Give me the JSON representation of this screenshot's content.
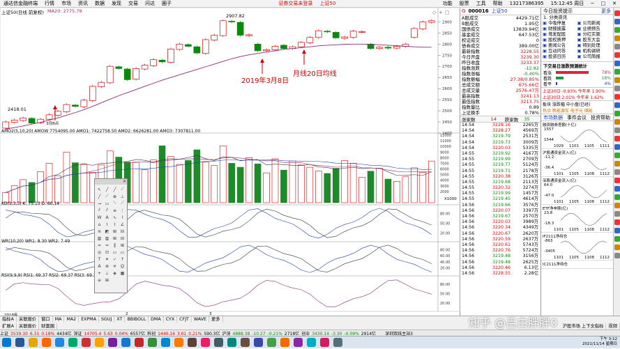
{
  "menubar": {
    "app_title": "通达信金融终端",
    "items": [
      "行情",
      "市场",
      "资讯",
      "数据",
      "发现",
      "交易",
      "问达",
      "圈子"
    ],
    "alert": "证券交易未登录",
    "index_label": "上证50",
    "right_items": [
      "功能",
      "股票",
      "工具",
      "帮助"
    ],
    "phone": "13217386395",
    "time": "15:12:45 周日"
  },
  "chart": {
    "title": "上证50(日线 前复权)",
    "ma_label": "MA20: 2775.79",
    "high_label": "2907.82",
    "low_label": "2418.01",
    "buy_point_label": "3月B点",
    "annotation_date": "2019年3月8日",
    "annotation_ma": "月线20日均线",
    "price_ticks": [
      "2900",
      "2850",
      "2800",
      "2750",
      "2700",
      "2650",
      "2600",
      "2550",
      "2500",
      "2450",
      "2400"
    ],
    "amo_label": "AMO2(5,10,20) AMOW 7754095.00 AMO1: 7422758.50 AMO2: 6626281.00 AMO3: 7307811.00",
    "amo_ticks": [
      "12000",
      "11000",
      "10000",
      "9000",
      "8000",
      "7000",
      "6000",
      "5000",
      "4000",
      "3000",
      "2000"
    ],
    "amo_unit": "X1000",
    "kdj_label": "KD(9,3,3) K: 75.13 D: 60.14",
    "kdj_ticks": [
      "80.00",
      "50.00",
      "20.00"
    ],
    "wr_label": "WR(10,20) WR1: 8.30 WR2: 7.49",
    "wr_ticks": [
      "80.00",
      "60.00",
      "40.00",
      "20.00"
    ],
    "rsi_label": "RSI(9,9,9) RSI1: 69.37 RSI2: 69.37 RSI3: 69.37",
    "rsi_ticks": [
      "80.00",
      "50.00",
      "20.00"
    ],
    "date_axis": [
      "2018年",
      "2",
      "3"
    ],
    "chart_data": {
      "type": "candlestick",
      "title": "上证50(日线 前复权)",
      "candles": [
        {
          "o": 2422,
          "c": 2450
        },
        {
          "o": 2448,
          "c": 2458
        },
        {
          "o": 2456,
          "c": 2468
        },
        {
          "o": 2466,
          "c": 2445
        },
        {
          "o": 2446,
          "c": 2462
        },
        {
          "o": 2462,
          "c": 2482
        },
        {
          "o": 2480,
          "c": 2498
        },
        {
          "o": 2496,
          "c": 2528
        },
        {
          "o": 2526,
          "c": 2520
        },
        {
          "o": 2518,
          "c": 2548
        },
        {
          "o": 2546,
          "c": 2610
        },
        {
          "o": 2608,
          "c": 2628
        },
        {
          "o": 2626,
          "c": 2700
        },
        {
          "o": 2698,
          "c": 2690
        },
        {
          "o": 2688,
          "c": 2640
        },
        {
          "o": 2642,
          "c": 2690
        },
        {
          "o": 2688,
          "c": 2705
        },
        {
          "o": 2703,
          "c": 2730
        },
        {
          "o": 2728,
          "c": 2720
        },
        {
          "o": 2718,
          "c": 2778
        },
        {
          "o": 2776,
          "c": 2800
        },
        {
          "o": 2798,
          "c": 2790
        },
        {
          "o": 2788,
          "c": 2760
        },
        {
          "o": 2758,
          "c": 2820
        },
        {
          "o": 2818,
          "c": 2840
        },
        {
          "o": 2838,
          "c": 2905
        },
        {
          "o": 2903,
          "c": 2900
        },
        {
          "o": 2898,
          "c": 2840
        },
        {
          "o": 2838,
          "c": 2842
        },
        {
          "o": 2800,
          "c": 2770
        },
        {
          "o": 2770,
          "c": 2775
        },
        {
          "o": 2774,
          "c": 2790
        },
        {
          "o": 2795,
          "c": 2780
        },
        {
          "o": 2780,
          "c": 2788
        },
        {
          "o": 2788,
          "c": 2808
        },
        {
          "o": 2806,
          "c": 2830
        },
        {
          "o": 2830,
          "c": 2860
        },
        {
          "o": 2858,
          "c": 2855
        },
        {
          "o": 2853,
          "c": 2828
        },
        {
          "o": 2826,
          "c": 2832
        },
        {
          "o": 2830,
          "c": 2858
        },
        {
          "o": 2856,
          "c": 2856
        },
        {
          "o": 2800,
          "c": 2780
        },
        {
          "o": 2780,
          "c": 2786
        },
        {
          "o": 2786,
          "c": 2782
        },
        {
          "o": 2782,
          "c": 2790
        },
        {
          "o": 2790,
          "c": 2800
        },
        {
          "o": 2830,
          "c": 2870
        },
        {
          "o": 2868,
          "c": 2900
        },
        {
          "o": 2898,
          "c": 2905
        }
      ],
      "ma20": [
        2418,
        2425,
        2432,
        2440,
        2448,
        2458,
        2468,
        2480,
        2492,
        2505,
        2520,
        2536,
        2552,
        2568,
        2582,
        2596,
        2610,
        2624,
        2638,
        2650,
        2662,
        2674,
        2686,
        2698,
        2710,
        2722,
        2734,
        2744,
        2752,
        2758,
        2764,
        2770,
        2776,
        2780,
        2784,
        2788,
        2792,
        2795,
        2797,
        2799,
        2800,
        2800,
        2799,
        2797,
        2795,
        2793,
        2790,
        2788,
        2786,
        2786
      ],
      "ylim": [
        2400,
        2920
      ],
      "amo": [
        1800,
        3000,
        4100,
        3600,
        5500,
        7000,
        4800,
        9000,
        7100,
        6800,
        5400,
        6700,
        9200,
        8100,
        7200,
        7200,
        5900,
        7600,
        10100,
        8200,
        6800,
        7500,
        9400,
        7200,
        6600,
        10100,
        7000,
        6300,
        8000,
        6900,
        5300,
        7800,
        5800,
        7400,
        6700,
        6300,
        5600,
        5200,
        6100,
        7500,
        7000,
        4500,
        5600,
        6100,
        4200,
        3800,
        4600,
        6200,
        5400,
        7400
      ],
      "amo_ylim": [
        0,
        12000
      ]
    }
  },
  "draw_toolbar": {
    "title": "画线工具"
  },
  "quote": {
    "code": "000016",
    "name": "上证50",
    "rows": [
      {
        "k": "A股成交",
        "v": "4429.71亿"
      },
      {
        "k": "B股成交",
        "v": "1.95亿"
      },
      {
        "k": "国债成交",
        "v": "13839.94亿"
      },
      {
        "k": "基金成交",
        "v": "647.53亿"
      },
      {
        "k": "权证成交",
        "v": "0"
      },
      {
        "k": "债券成交",
        "v": "389.00亿"
      },
      {
        "k": "最新指数",
        "v": "3228.55"
      },
      {
        "k": "今日开盘",
        "v": "3239.30"
      },
      {
        "k": "昨日收盘",
        "v": "3233.37"
      },
      {
        "k": "指数涨跌",
        "v": "-12.82"
      },
      {
        "k": "指数涨幅",
        "v": "-0.40%"
      },
      {
        "k": "指数振幅",
        "v": "27.38/0.85%"
      },
      {
        "k": "总成交额",
        "v": "675.66亿"
      },
      {
        "k": "总成交量",
        "v": "2576.47万"
      },
      {
        "k": "最高指数",
        "v": "3241.13"
      },
      {
        "k": "最低指数",
        "v": "3213.75"
      },
      {
        "k": "指数量比",
        "v": "0.89"
      },
      {
        "k": "上证换手",
        "v": "0.78%"
      }
    ],
    "rise_label": "涨家数",
    "rise_value": "14",
    "fall_label": "跌家数",
    "fall_value": "35",
    "ticks": [
      [
        "14:54",
        "3228.16",
        "2265万"
      ],
      [
        "14:54",
        "3228.27",
        "4569万"
      ],
      [
        "14:54",
        "3219.79",
        "2531万"
      ],
      [
        "14:54",
        "3219.73",
        "3009万"
      ],
      [
        "14:54",
        "3220.03",
        "5335万"
      ],
      [
        "14:55",
        "3219.92",
        "4167万"
      ],
      [
        "14:55",
        "3219.99",
        "2709万"
      ],
      [
        "14:55",
        "3219.77",
        "5124万"
      ],
      [
        "14:55",
        "3219.71",
        "2178万"
      ],
      [
        "14:55",
        "3220.38",
        "3126万"
      ],
      [
        "14:55",
        "3219.68",
        "2113万"
      ],
      [
        "14:55",
        "3220.32",
        "3274万"
      ],
      [
        "14:55",
        "3219.99",
        "1457万"
      ],
      [
        "14:55",
        "3219.45",
        "4614万"
      ],
      [
        "14:56",
        "3219.66",
        "3576万"
      ],
      [
        "14:56",
        "3220.07",
        "3397万"
      ],
      [
        "14:56",
        "3219.67",
        "2570万"
      ],
      [
        "14:56",
        "3220.03",
        "3989万"
      ],
      [
        "14:56",
        "3220.34",
        "4349万"
      ],
      [
        "14:56",
        "3220.67",
        "2620万"
      ],
      [
        "14:56",
        "3220.59",
        "2637万"
      ],
      [
        "14:56",
        "3220.61",
        "5743万"
      ],
      [
        "14:56",
        "3220.76",
        "5724万"
      ],
      [
        "14:56",
        "3219.48",
        "3156万"
      ],
      [
        "14:56",
        "3219.48",
        "2625万"
      ],
      [
        "14:56",
        "3220.46",
        "6.13亿"
      ],
      [
        "14:56",
        "3228.55",
        "2.28亿"
      ]
    ]
  },
  "news": {
    "header": "今日投资提示",
    "more": "更多",
    "subheader": "1. 分类资讯",
    "grid": [
      "今吸停复",
      "公司新闻",
      "财报披露",
      "业绩预告",
      "增发配股",
      "分红实施",
      "股权质押",
      "股东大会",
      "要闻公告",
      "特别处理",
      "互动问答",
      "机构调研",
      "投资日历",
      "公司简报"
    ],
    "sentiment_title": "下交易日涨跌预测统计",
    "sentiment_labels": [
      "看涨",
      "看跌",
      "看平"
    ],
    "sentiment_values": [
      "78%",
      "18%",
      "4%"
    ],
    "compare_rows": [
      "上证20日 -0.93% 今年来 1.90%",
      "上证20日 2.01% 今年来 1.62%"
    ],
    "rank_label": "板块 涨跌幅 中小盘(已经)",
    "hot_label": "热点 新能源车 电子元 储能",
    "tabs": [
      "市场数据",
      "事件会议",
      "投资帮助"
    ],
    "mini_charts": [
      {
        "title": "融资融券差额(十亿)",
        "ticks": [
          "1557",
          "1544"
        ],
        "dates": [
          "1029",
          "1101",
          "1105",
          "1111"
        ]
      },
      {
        "title": "沪股通资金流入(亿)",
        "ticks": [
          "-11.2",
          "-36.4"
        ],
        "dates": [
          "1101",
          "1105",
          "1108",
          "1112"
        ]
      },
      {
        "title": "深股通资金流入(亿)",
        "ticks": [
          "64.0",
          "-47.0"
        ],
        "dates": [
          "1101",
          "1105",
          "1108",
          "1112"
        ]
      },
      {
        "title": "ETF净申赎(亿)",
        "ticks": [
          "23.8",
          "-18.3"
        ],
        "dates": [
          "1101",
          "1105",
          "1108",
          "1112"
        ]
      },
      {
        "title": "IF2111净持仓",
        "ticks": [
          "-863",
          "-3405"
        ],
        "dates": [
          "1101",
          "1105",
          "1108",
          "1112"
        ]
      },
      {
        "title": "IC2111净持仓",
        "ticks": [],
        "dates": []
      }
    ]
  },
  "bottom_tabs": [
    "指标A",
    "关联报价",
    "窗口",
    "MA",
    "MA2",
    "EXPMA",
    "SGUJ",
    "XT",
    "BBIBOLL",
    "DMA",
    "CYX",
    "CFJT",
    "WAVE",
    "更多"
  ],
  "bottom_tabs2": [
    "扩展A",
    "关联报价",
    "财富圈"
  ],
  "status_right": "视频",
  "status_msg": "沪股市场 上下文指标",
  "statusbar": {
    "items": [
      {
        "t": "上证",
        "c": "#000"
      },
      {
        "t": "3539.10",
        "c": "#d00"
      },
      {
        "t": "6.31",
        "c": "#d00"
      },
      {
        "t": "0.18%",
        "c": "#d00"
      },
      {
        "t": "4434亿",
        "c": "#000"
      },
      {
        "t": "深证",
        "c": "#000"
      },
      {
        "t": "14705.4",
        "c": "#d00"
      },
      {
        "t": "5.63",
        "c": "#d00"
      },
      {
        "t": "0.04%",
        "c": "#d00"
      },
      {
        "t": "6557亿",
        "c": "#000"
      },
      {
        "t": "科创",
        "c": "#000"
      },
      {
        "t": "1440.16",
        "c": "#d00"
      },
      {
        "t": "3.01",
        "c": "#d00"
      },
      {
        "t": "0.21%",
        "c": "#d00"
      },
      {
        "t": "590.3亿",
        "c": "#000"
      },
      {
        "t": "沪深",
        "c": "#000"
      },
      {
        "t": "4888.38",
        "c": "#0a8a0a"
      },
      {
        "t": "-10.27",
        "c": "#0a8a0a"
      },
      {
        "t": "-0.21%",
        "c": "#0a8a0a"
      },
      {
        "t": "2718亿",
        "c": "#000"
      },
      {
        "t": "创业",
        "c": "#000"
      },
      {
        "t": "3430.14",
        "c": "#0a8a0a"
      },
      {
        "t": "-3.30",
        "c": "#0a8a0a"
      },
      {
        "t": "-0.09%",
        "c": "#0a8a0a"
      },
      {
        "t": "2914亿",
        "c": "#000"
      }
    ],
    "right": "深圳双线主站3"
  },
  "watermark": "知乎 @吕白胖胖0",
  "taskbar": {
    "time": "下午 3:12",
    "date": "2021/11/14 星期日"
  }
}
